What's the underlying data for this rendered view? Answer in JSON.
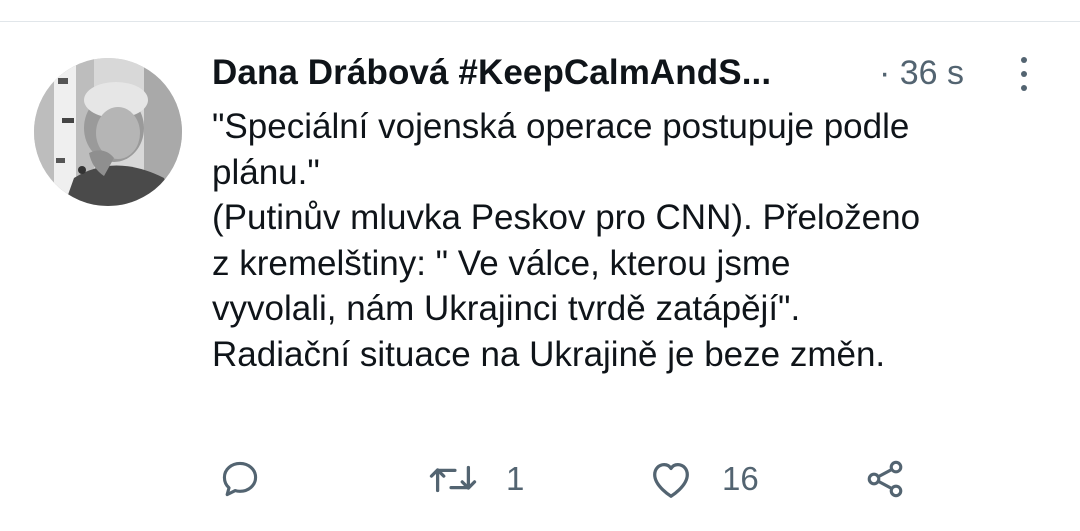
{
  "tweet": {
    "author_name": "Dana Drábová #KeepCalmAndS...",
    "dot_time": "· 36 s",
    "text_lines": [
      "\"Speciální vojenská operace postupuje podle",
      "plánu.\"",
      "(Putinův mluvka Peskov pro CNN). Přeloženo",
      "z kremelštiny: \" Ve válce, kterou jsme",
      "vyvolali, nám Ukrajinci tvrdě zatápějí\".",
      "Radiační situace na Ukrajině je beze změn."
    ],
    "actions": {
      "reply_icon": "reply-icon",
      "retweet_icon": "retweet-icon",
      "retweet_count": "1",
      "like_icon": "heart-icon",
      "like_count": "16",
      "share_icon": "share-icon"
    },
    "colors": {
      "text": "#0f1419",
      "secondary": "#536471",
      "divider": "#e1e6ea"
    }
  }
}
